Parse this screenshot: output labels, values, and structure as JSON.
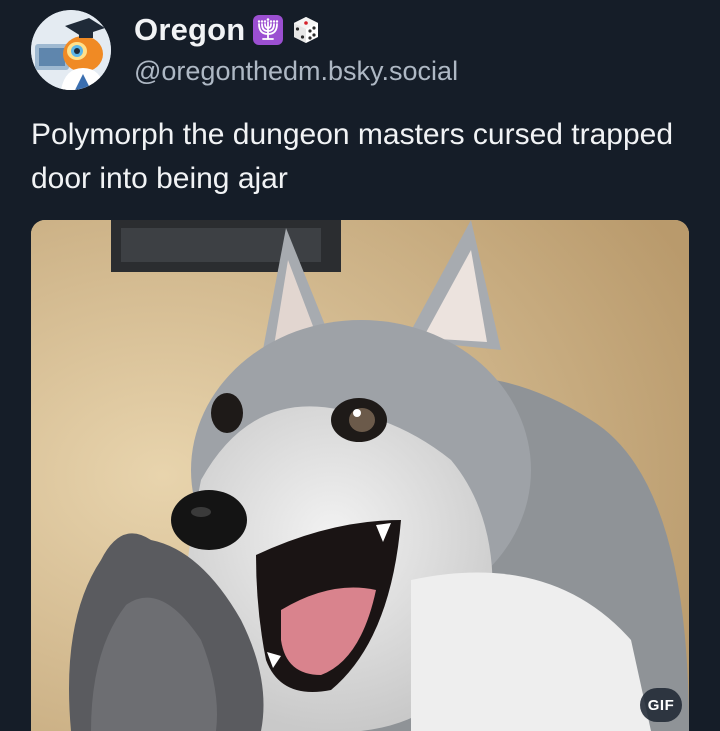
{
  "post": {
    "display_name": "Oregon",
    "handle": "@oregonthedm.bsky.social",
    "name_emojis": [
      "menorah-emoji",
      "dice-emoji"
    ],
    "text": "Polymorph the dungeon masters cursed trapped door into being ajar",
    "media": {
      "type": "gif",
      "badge": "GIF",
      "subject": "husky-dog-image"
    }
  },
  "colors": {
    "background": "#151d28",
    "text_primary": "#f1f3f5",
    "text_secondary": "#aeb8c4",
    "badge_bg": "#202834"
  }
}
